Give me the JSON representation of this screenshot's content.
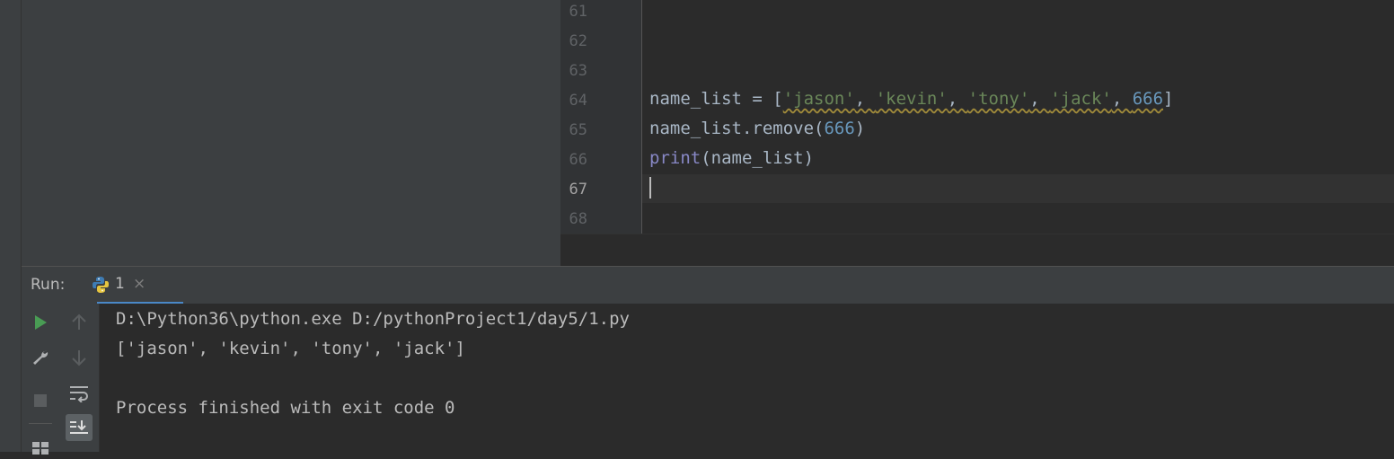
{
  "editor": {
    "line_numbers": [
      "61",
      "62",
      "63",
      "64",
      "65",
      "66",
      "67",
      "68"
    ],
    "current_line": "67",
    "code": {
      "line64": {
        "var": "name_list = [",
        "s1": "'jason'",
        "c1": ", ",
        "s2": "'kevin'",
        "c2": ", ",
        "s3": "'tony'",
        "c3": ", ",
        "s4": "'jack'",
        "c4": ", ",
        "n1": "666",
        "end": "]"
      },
      "line65": {
        "pre": "name_list.remove(",
        "num": "666",
        "post": ")"
      },
      "line66": {
        "fn": "print",
        "args": "(name_list)"
      }
    }
  },
  "run_panel": {
    "label": "Run:",
    "tab": {
      "label": "1",
      "close": "×"
    },
    "console": [
      "D:\\Python36\\python.exe D:/pythonProject1/day5/1.py",
      "['jason', 'kevin', 'tony', 'jack']",
      "",
      "Process finished with exit code 0"
    ]
  },
  "toolbar": {
    "icons": [
      "run-icon",
      "wrench-icon",
      "stop-icon",
      "layout-icon",
      "up-arrow-icon",
      "down-arrow-icon",
      "soft-wrap-icon",
      "scroll-to-end-icon"
    ]
  },
  "colors": {
    "background": "#2b2b2b",
    "panel": "#3c3f41",
    "string": "#6a8759",
    "number": "#6897bb",
    "builtin": "#8888c6",
    "run_green": "#499c54",
    "tab_underline": "#4a88c7"
  }
}
